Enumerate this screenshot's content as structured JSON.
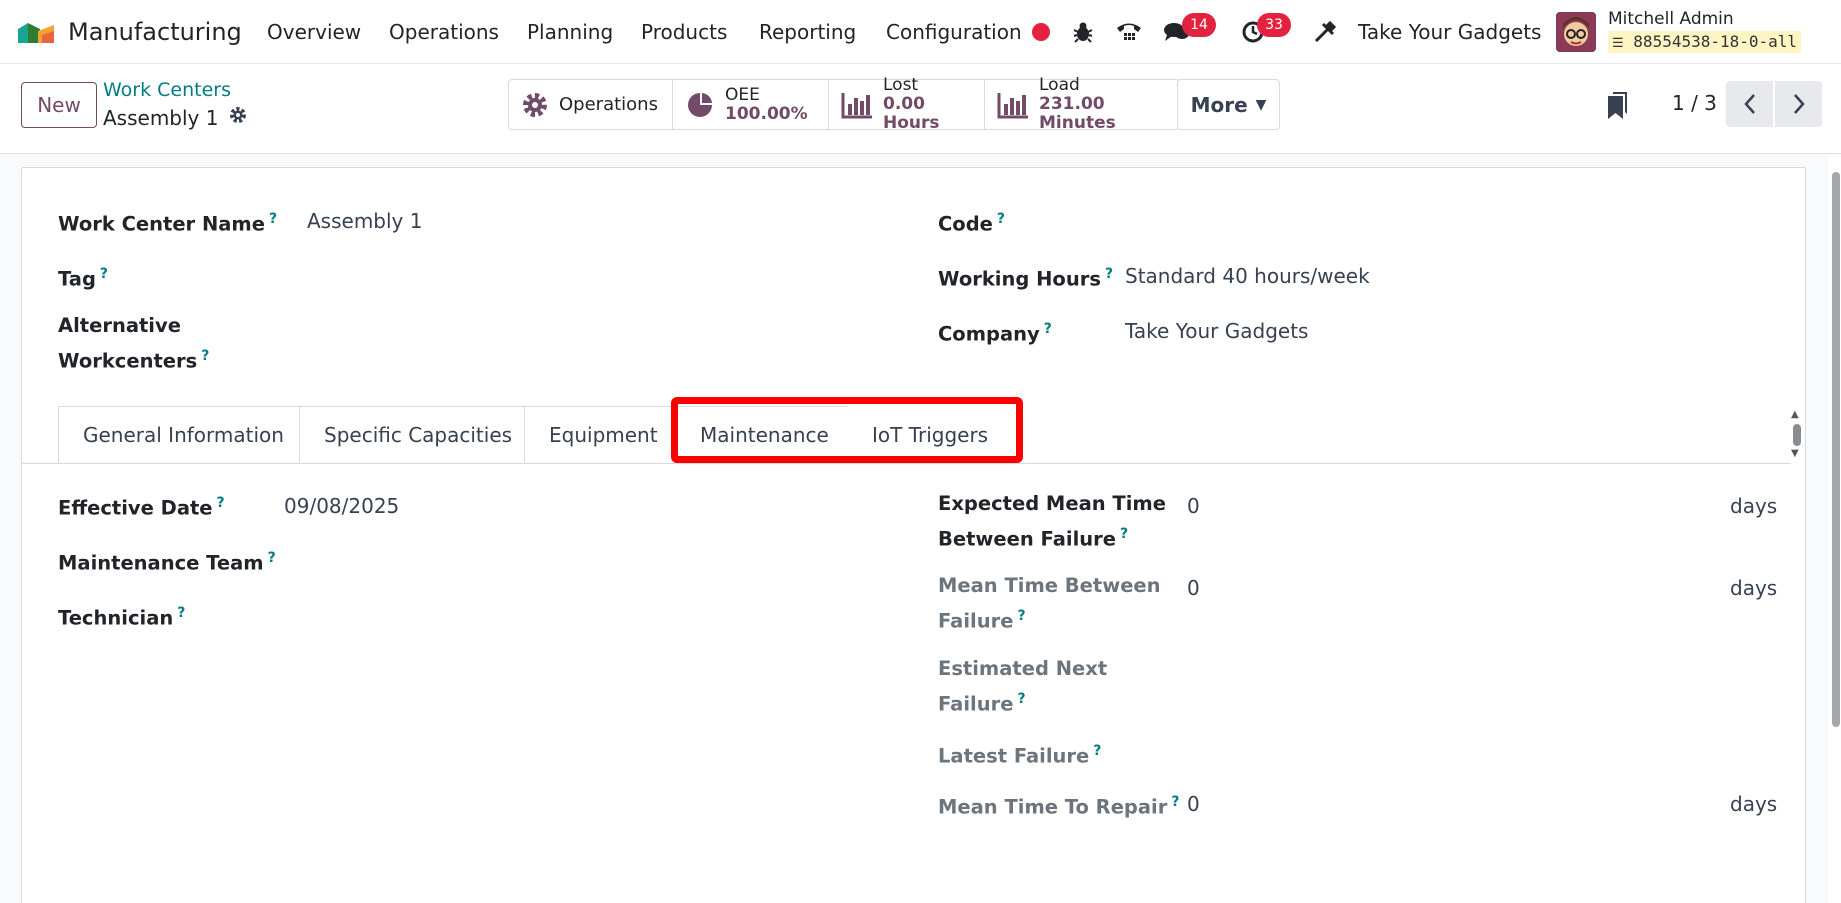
{
  "navbar": {
    "app_name": "Manufacturing",
    "menus": [
      "Overview",
      "Operations",
      "Planning",
      "Products",
      "Reporting",
      "Configuration"
    ],
    "messages_count": "14",
    "activities_count": "33",
    "company": "Take Your Gadgets",
    "user_name": "Mitchell Admin",
    "database": "88554538-18-0-all"
  },
  "control": {
    "new_label": "New",
    "breadcrumb": "Work Centers",
    "record_name": "Assembly 1",
    "stats": {
      "operations_label": "Operations",
      "oee_label": "OEE",
      "oee_value": "100.00%",
      "lost_label": "Lost",
      "lost_value": "0.00 Hours",
      "load_label": "Load",
      "load_value": "231.00 Minutes"
    },
    "more_label": "More",
    "pager": "1 / 3"
  },
  "form": {
    "work_center_name_label": "Work Center Name",
    "work_center_name_value": "Assembly 1",
    "tag_label": "Tag",
    "alternative_label_1": "Alternative",
    "alternative_label_2": "Workcenters",
    "code_label": "Code",
    "working_hours_label": "Working Hours",
    "working_hours_value": "Standard 40 hours/week",
    "company_label": "Company",
    "company_value": "Take Your Gadgets"
  },
  "tabs": [
    "General Information",
    "Specific Capacities",
    "Equipment",
    "Maintenance",
    "IoT Triggers"
  ],
  "maintenance": {
    "effective_date_label": "Effective Date",
    "effective_date_value": "09/08/2025",
    "maintenance_team_label": "Maintenance Team",
    "technician_label": "Technician",
    "expected_mtbf_label_1": "Expected Mean Time",
    "expected_mtbf_label_2": "Between Failure",
    "expected_mtbf_value": "0",
    "mtbf_label_1": "Mean Time Between",
    "mtbf_label_2": "Failure",
    "mtbf_value": "0",
    "est_next_failure_label_1": "Estimated Next",
    "est_next_failure_label_2": "Failure",
    "latest_failure_label": "Latest Failure",
    "mttr_label": "Mean Time To Repair",
    "mttr_value": "0",
    "unit": "days",
    "help_mark": "?"
  },
  "colors": {
    "brand": "#714b67",
    "link": "#017e84",
    "badge": "#e3223f",
    "highlight": "#ff0000"
  },
  "icons": [
    "app-logo-icon",
    "record-dot-icon",
    "bug-icon",
    "phone-icon",
    "chat-icon",
    "clock-icon",
    "tools-icon",
    "gear-icon",
    "pie-chart-icon",
    "bar-chart-icon",
    "caret-down-icon",
    "bookmark-icon",
    "chevron-left-icon",
    "chevron-right-icon"
  ]
}
